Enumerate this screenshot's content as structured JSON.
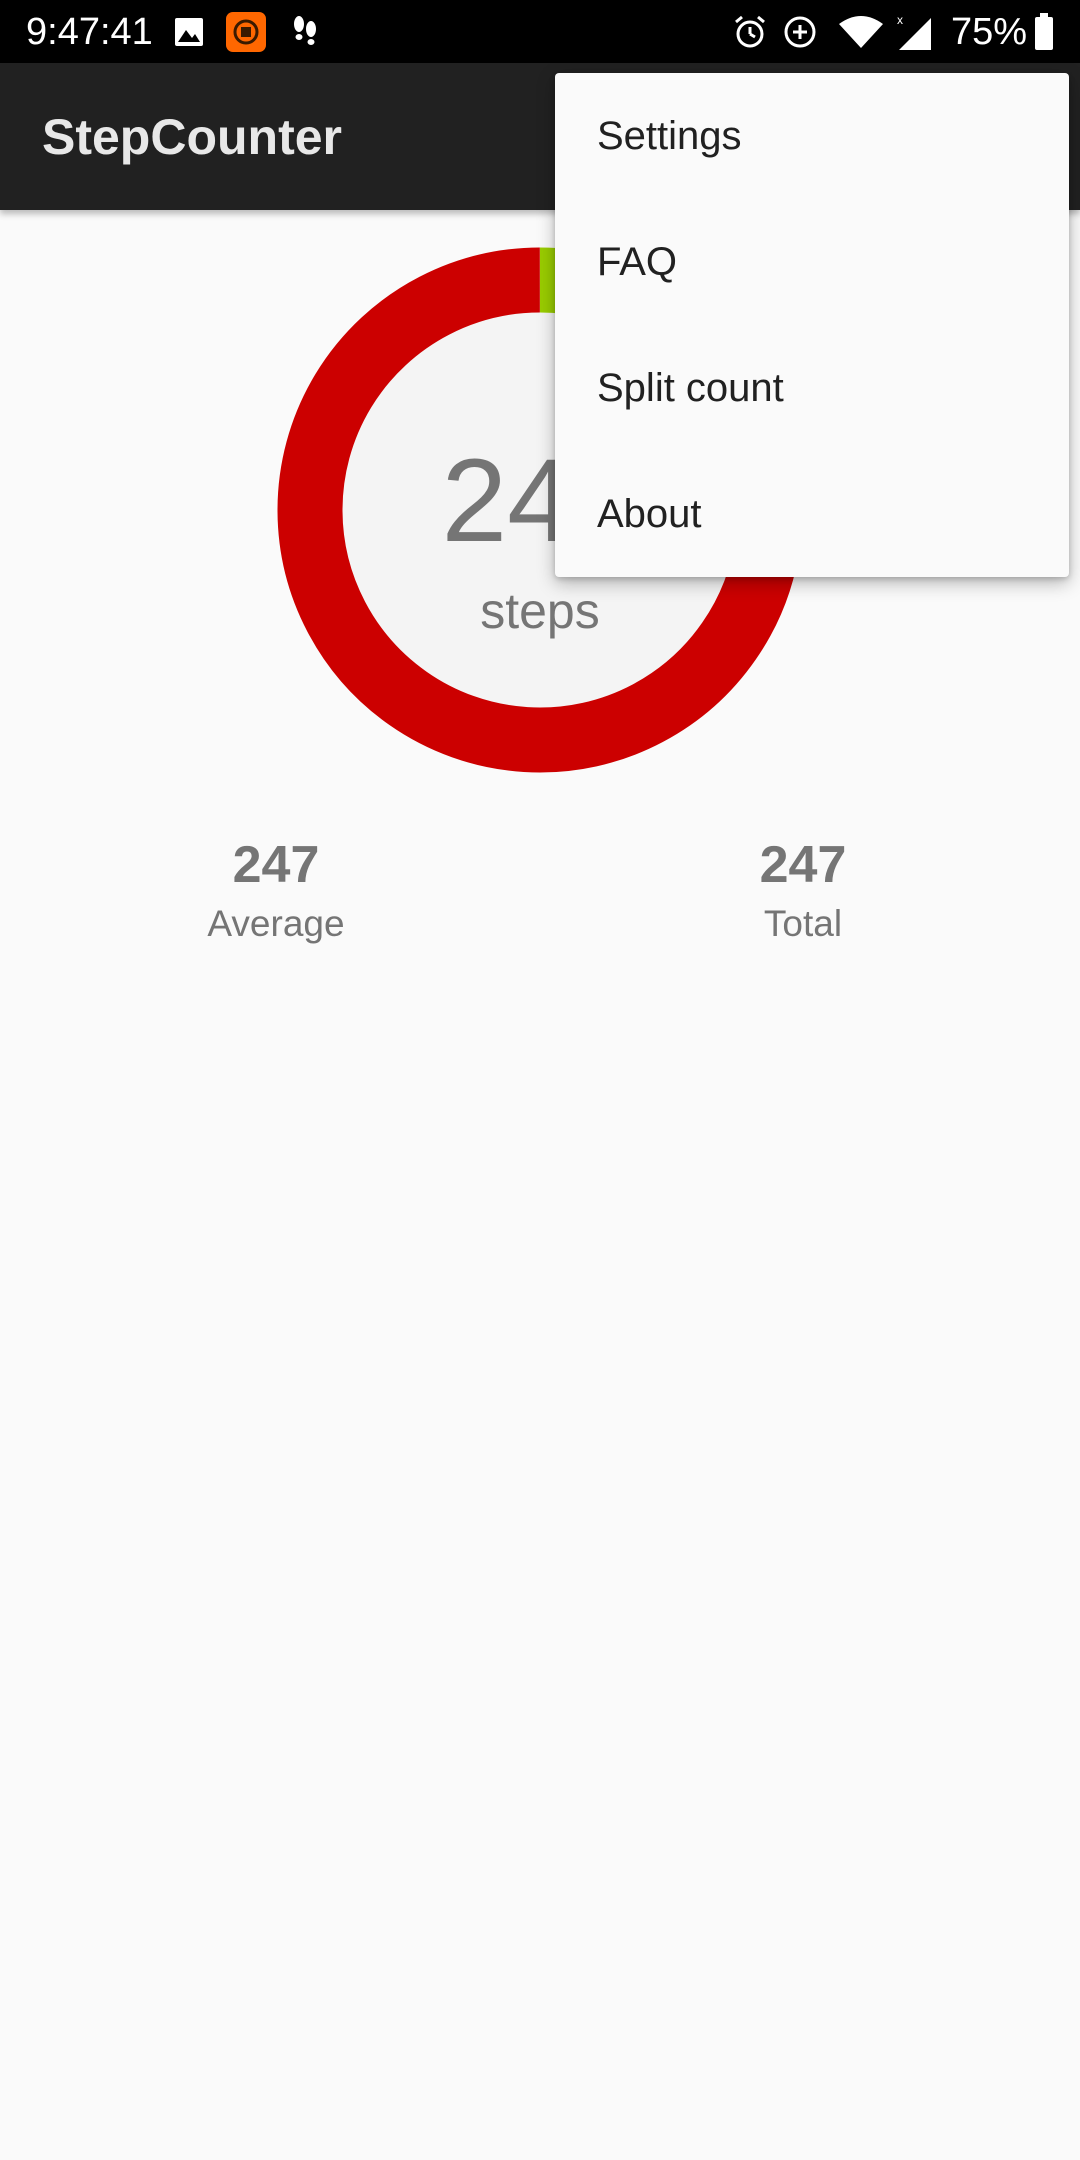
{
  "status_bar": {
    "time": "9:47:41",
    "left_icons": [
      "image-icon",
      "mi-app-icon",
      "footsteps-icon"
    ],
    "right_icons": [
      "alarm-icon",
      "data-saver-icon",
      "wifi-icon",
      "signal-icon",
      "battery-icon"
    ],
    "battery_percent": "75%"
  },
  "app_bar": {
    "title": "StepCounter"
  },
  "donut": {
    "center_value": "247",
    "center_label": "steps",
    "segments": [
      {
        "name": "remaining",
        "fraction": 0.98,
        "color": "#cc0000"
      },
      {
        "name": "progress",
        "fraction": 0.02,
        "color": "#99cc00"
      }
    ],
    "track_color": "#f4f4f4"
  },
  "stats": {
    "average_value": "247",
    "average_label": "Average",
    "total_value": "247",
    "total_label": "Total"
  },
  "menu": {
    "items": [
      {
        "label": "Settings"
      },
      {
        "label": "FAQ"
      },
      {
        "label": "Split count"
      },
      {
        "label": "About"
      }
    ]
  },
  "colors": {
    "status_bar": "#000000",
    "app_bar": "#212121",
    "background": "#fafafa",
    "ring_red": "#cc0000",
    "ring_green": "#99cc00",
    "text_gray": "#757575"
  }
}
